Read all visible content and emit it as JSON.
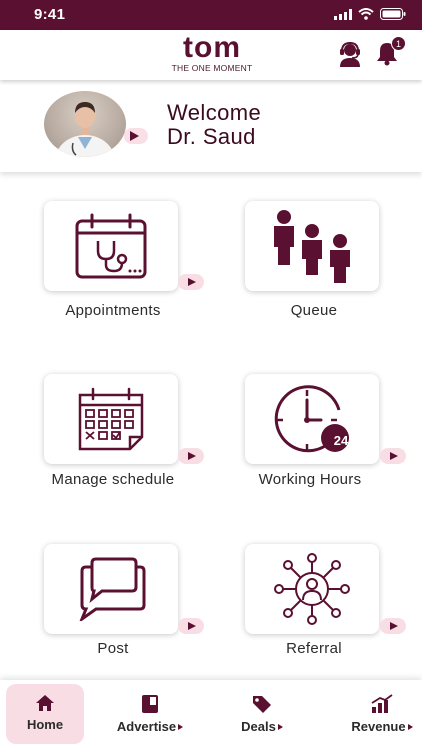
{
  "status_bar": {
    "time": "9:41"
  },
  "header": {
    "logo_word": "tom",
    "logo_tagline": "THE ONE MOMENT",
    "notification_count": "1"
  },
  "welcome": {
    "greeting": "Welcome",
    "name": "Dr. Saud"
  },
  "tiles": {
    "appointments": {
      "label": "Appointments",
      "icon": "calendar-stethoscope-icon"
    },
    "queue": {
      "label": "Queue",
      "icon": "people-queue-icon"
    },
    "manage_schedule": {
      "label": "Manage schedule",
      "icon": "calendar-grid-icon"
    },
    "working_hours": {
      "label": "Working Hours",
      "icon": "clock-24-icon",
      "badge": "24"
    },
    "post": {
      "label": "Post",
      "icon": "chat-bubbles-icon"
    },
    "referral": {
      "label": "Referral",
      "icon": "network-person-icon"
    }
  },
  "nav": {
    "home": "Home",
    "advertise": "Advertise",
    "deals": "Deals",
    "revenue": "Revenue"
  },
  "colors": {
    "brand": "#5a1030",
    "accent_light": "#f8dde4"
  }
}
